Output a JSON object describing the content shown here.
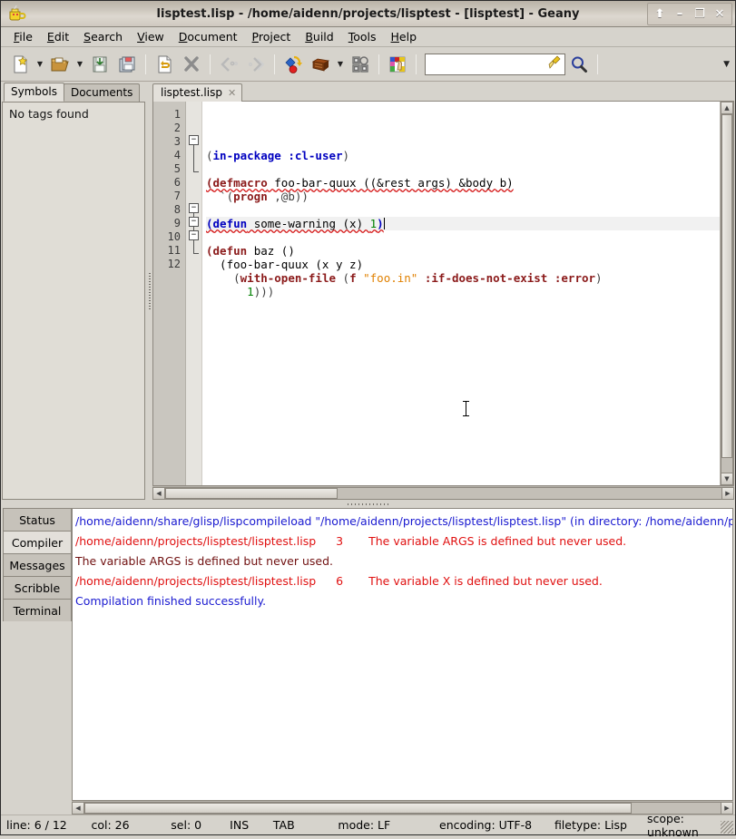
{
  "window": {
    "title": "lisptest.lisp - /home/aidenn/projects/lisptest - [lisptest] - Geany",
    "app_icon": "geany-lamp-icon",
    "buttons": {
      "shade": "⬆",
      "minimize": "–",
      "maximize": "❐",
      "close": "✕"
    }
  },
  "menubar": [
    {
      "label": "File",
      "mnemonic": "F"
    },
    {
      "label": "Edit",
      "mnemonic": "E"
    },
    {
      "label": "Search",
      "mnemonic": "S"
    },
    {
      "label": "View",
      "mnemonic": "V"
    },
    {
      "label": "Document",
      "mnemonic": "D"
    },
    {
      "label": "Project",
      "mnemonic": "P"
    },
    {
      "label": "Build",
      "mnemonic": "B"
    },
    {
      "label": "Tools",
      "mnemonic": "T"
    },
    {
      "label": "Help",
      "mnemonic": "H"
    }
  ],
  "toolbar": {
    "items": [
      {
        "name": "new-document-button",
        "icon": "new-document-icon",
        "dropdown": true
      },
      {
        "name": "open-file-button",
        "icon": "open-folder-icon",
        "dropdown": true
      },
      {
        "name": "save-button",
        "icon": "save-icon",
        "dropdown": false
      },
      {
        "name": "save-all-button",
        "icon": "save-all-icon",
        "dropdown": false
      },
      {
        "name": "reload-button",
        "icon": "reload-icon",
        "dropdown": false
      },
      {
        "name": "close-document-button",
        "icon": "close-x-icon",
        "dropdown": false
      },
      {
        "name": "navigate-back-button",
        "icon": "arrow-back-icon",
        "dropdown": false
      },
      {
        "name": "navigate-forward-button",
        "icon": "arrow-forward-icon",
        "dropdown": false
      },
      {
        "name": "compile-button",
        "icon": "compile-icon",
        "dropdown": false
      },
      {
        "name": "build-button",
        "icon": "build-brick-icon",
        "dropdown": true
      },
      {
        "name": "run-button",
        "icon": "gears-run-icon",
        "dropdown": false
      },
      {
        "name": "color-chooser-button",
        "icon": "color-picker-icon",
        "dropdown": false
      }
    ],
    "search": {
      "value": "",
      "placeholder": "",
      "clear_icon": "broom-clear-icon",
      "go_icon": "magnifier-search-icon"
    },
    "overflow_icon": "chevron-down-icon"
  },
  "sidebar": {
    "tabs": [
      {
        "label": "Symbols",
        "active": true
      },
      {
        "label": "Documents",
        "active": false
      }
    ],
    "empty_message": "No tags found"
  },
  "editor": {
    "tabs": [
      {
        "label": "lisptest.lisp",
        "active": true,
        "close_icon": "close-tab-icon"
      }
    ],
    "line_numbers": [
      "1",
      "2",
      "3",
      "4",
      "5",
      "6",
      "7",
      "8",
      "9",
      "10",
      "11",
      "12"
    ],
    "current_line": 6,
    "lines": [
      {
        "n": 1,
        "tokens": [
          {
            "t": "(",
            "c": "par"
          },
          {
            "t": "in-package",
            "c": "k"
          },
          {
            "t": " ",
            "c": "sym"
          },
          {
            "t": ":cl-user",
            "c": "k"
          },
          {
            "t": ")",
            "c": "par"
          }
        ]
      },
      {
        "n": 2,
        "tokens": []
      },
      {
        "n": 3,
        "tokens": [
          {
            "t": "(",
            "c": "kw"
          },
          {
            "t": "defmacro",
            "c": "kw"
          },
          {
            "t": " foo-bar-quux ((&rest args) &body b)",
            "c": "sym"
          }
        ],
        "squiggle": true
      },
      {
        "n": 4,
        "tokens": [
          {
            "t": "  `(",
            "c": "par"
          },
          {
            "t": "progn",
            "c": "kw"
          },
          {
            "t": " ,@b))",
            "c": "par"
          }
        ]
      },
      {
        "n": 5,
        "tokens": []
      },
      {
        "n": 6,
        "tokens": [
          {
            "t": "(",
            "c": "k"
          },
          {
            "t": "defun",
            "c": "k"
          },
          {
            "t": " some-warning (x) ",
            "c": "sym"
          },
          {
            "t": "1",
            "c": "num"
          },
          {
            "t": ")",
            "c": "k"
          }
        ],
        "squiggle": true,
        "caret": true
      },
      {
        "n": 7,
        "tokens": []
      },
      {
        "n": 8,
        "tokens": [
          {
            "t": "(",
            "c": "kw"
          },
          {
            "t": "defun",
            "c": "kw"
          },
          {
            "t": " baz ()",
            "c": "sym"
          }
        ]
      },
      {
        "n": 9,
        "tokens": [
          {
            "t": "  (foo-bar-quux (x y z)",
            "c": "sym"
          }
        ]
      },
      {
        "n": 10,
        "tokens": [
          {
            "t": "    (",
            "c": "par"
          },
          {
            "t": "with-open-file",
            "c": "kw"
          },
          {
            "t": " (",
            "c": "par"
          },
          {
            "t": "f",
            "c": "kw"
          },
          {
            "t": " ",
            "c": "sym"
          },
          {
            "t": "\"foo.in\"",
            "c": "str"
          },
          {
            "t": " ",
            "c": "sym"
          },
          {
            "t": ":if-does-not-exist",
            "c": "kw"
          },
          {
            "t": " ",
            "c": "sym"
          },
          {
            "t": ":error",
            "c": "kw"
          },
          {
            "t": ")",
            "c": "par"
          }
        ]
      },
      {
        "n": 11,
        "tokens": [
          {
            "t": "      ",
            "c": "sym"
          },
          {
            "t": "1",
            "c": "num"
          },
          {
            "t": ")))",
            "c": "par"
          }
        ]
      },
      {
        "n": 12,
        "tokens": []
      }
    ]
  },
  "message_panel": {
    "tabs": [
      {
        "label": "Status",
        "active": false
      },
      {
        "label": "Compiler",
        "active": true
      },
      {
        "label": "Messages",
        "active": false
      },
      {
        "label": "Scribble",
        "active": false
      },
      {
        "label": "Terminal",
        "active": false
      }
    ],
    "rows": [
      {
        "color": "#1a1ad0",
        "cells": [
          {
            "text": "/home/aidenn/share/glisp/lispcompileload \"/home/aidenn/projects/lisptest/lisptest.lisp\" (in directory: /home/aidenn/pro",
            "col": "c1"
          }
        ]
      },
      {
        "color": "#e01010",
        "cells": [
          {
            "text": "/home/aidenn/projects/lisptest/lisptest.lisp",
            "col": "c1"
          },
          {
            "text": "3",
            "col": "c2"
          },
          {
            "text": "The variable ARGS is defined but never used.",
            "col": "c3"
          }
        ]
      },
      {
        "color": "#701010",
        "cells": [
          {
            "text": "The variable ARGS is defined but never used.",
            "col": "c1"
          }
        ]
      },
      {
        "color": "#e01010",
        "cells": [
          {
            "text": "/home/aidenn/projects/lisptest/lisptest.lisp",
            "col": "c1"
          },
          {
            "text": "6",
            "col": "c2"
          },
          {
            "text": "The variable X is defined but never used.",
            "col": "c3"
          }
        ]
      },
      {
        "color": "#1a1ad0",
        "cells": [
          {
            "text": "Compilation finished successfully.",
            "col": "c1"
          }
        ]
      }
    ]
  },
  "statusbar": {
    "line": "line: 6 / 12",
    "col": "col: 26",
    "sel": "sel: 0",
    "insert_mode": "INS",
    "indent": "TAB",
    "eol_mode": "mode: LF",
    "encoding": "encoding: UTF-8",
    "filetype": "filetype: Lisp",
    "scope": "scope: unknown"
  },
  "colors": {
    "chrome": "#d6d3cc",
    "panel": "#e0ddd6",
    "editor_bg": "#ffffff",
    "gutter": "#c9c6bf",
    "keyword_blue": "#0000c0",
    "keyword_red": "#8b1a1a",
    "string_orange": "#e08000",
    "number_green": "#008000",
    "error_red": "#e01010",
    "info_blue": "#1a1ad0"
  }
}
